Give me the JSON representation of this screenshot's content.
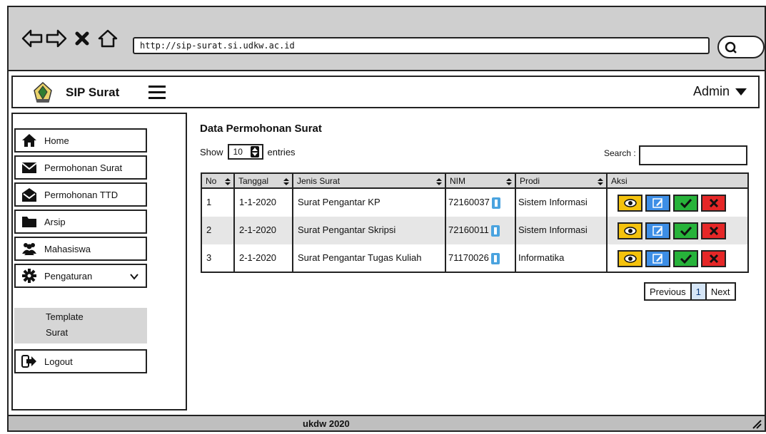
{
  "browser": {
    "url": "http://sip-surat.si.udkw.ac.id"
  },
  "header": {
    "app_title": "SIP Surat",
    "user_label": "Admin"
  },
  "sidebar": {
    "items": [
      {
        "label": "Home",
        "icon": "home-icon"
      },
      {
        "label": "Permohonan Surat",
        "icon": "envelope-icon"
      },
      {
        "label": "Permohonan TTD",
        "icon": "envelope-open-icon"
      },
      {
        "label": "Arsip",
        "icon": "folder-icon"
      },
      {
        "label": "Mahasiswa",
        "icon": "users-icon"
      },
      {
        "label": "Pengaturan",
        "icon": "gear-icon"
      },
      {
        "label": "Logout",
        "icon": "logout-icon"
      }
    ],
    "submenu": [
      "Template",
      "Surat"
    ]
  },
  "main": {
    "title": "Data Permohonan Surat",
    "show_label": "Show",
    "entries_value": "10",
    "entries_label": "entries",
    "search_label": "Search :",
    "search_value": ""
  },
  "table": {
    "columns": [
      "No",
      "Tanggal",
      "Jenis Surat",
      "NIM",
      "Prodi",
      "Aksi"
    ],
    "rows": [
      {
        "no": "1",
        "tanggal": "1-1-2020",
        "jenis": "Surat Pengantar KP",
        "nim": "72160037",
        "prodi": "Sistem Informasi"
      },
      {
        "no": "2",
        "tanggal": "2-1-2020",
        "jenis": "Surat Pengantar Skripsi",
        "nim": "72160011",
        "prodi": "Sistem Informasi"
      },
      {
        "no": "3",
        "tanggal": "2-1-2020",
        "jenis": "Surat Pengantar Tugas Kuliah",
        "nim": "71170026",
        "prodi": "Informatika"
      }
    ]
  },
  "pagination": {
    "previous": "Previous",
    "current": "1",
    "next": "Next"
  },
  "footer": {
    "text": "ukdw 2020"
  },
  "colors": {
    "view": "#f4c20d",
    "edit": "#3d8ee6",
    "approve": "#27b33a",
    "delete": "#e52727"
  }
}
